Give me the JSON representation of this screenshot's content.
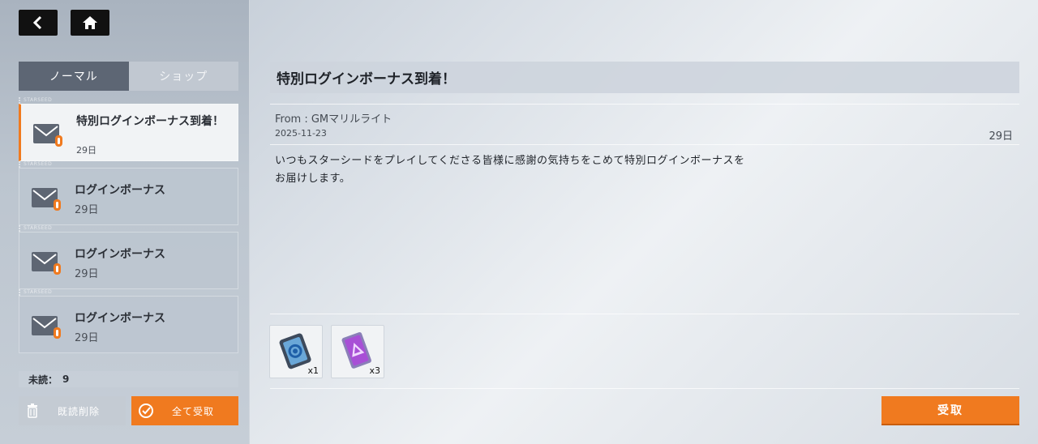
{
  "nav": {
    "back_icon": "chevron-left-icon",
    "home_icon": "home-icon"
  },
  "tabs": [
    {
      "label": "ノーマル",
      "active": true
    },
    {
      "label": "ショップ",
      "active": false
    }
  ],
  "separator_text": "STARSEED",
  "mails": [
    {
      "title": "特別ログインボーナス到着！",
      "date": "29日",
      "selected": true
    },
    {
      "title": "ログインボーナス",
      "date": "29日",
      "selected": false
    },
    {
      "title": "ログインボーナス",
      "date": "29日",
      "selected": false
    },
    {
      "title": "ログインボーナス",
      "date": "29日",
      "selected": false
    }
  ],
  "unread": {
    "label": "未読：",
    "count": "9"
  },
  "buttons": {
    "delete_read": "既読削除",
    "claim_all": "全て受取",
    "claim": "受取"
  },
  "detail": {
    "title": "特別ログインボーナス到着！",
    "from": "From : GMマリルライト",
    "sent_date": "2025-11-23",
    "expire": "29日",
    "body": "いつもスターシードをプレイしてくださる皆様に感謝の気持ちをこめて特別ログインボーナスをお届けします。"
  },
  "rewards": [
    {
      "icon": "device-item-icon",
      "qty": "x1"
    },
    {
      "icon": "ticket-item-icon",
      "qty": "x3"
    }
  ],
  "colors": {
    "accent": "#f07a1f",
    "tab_active": "#5d6674"
  }
}
